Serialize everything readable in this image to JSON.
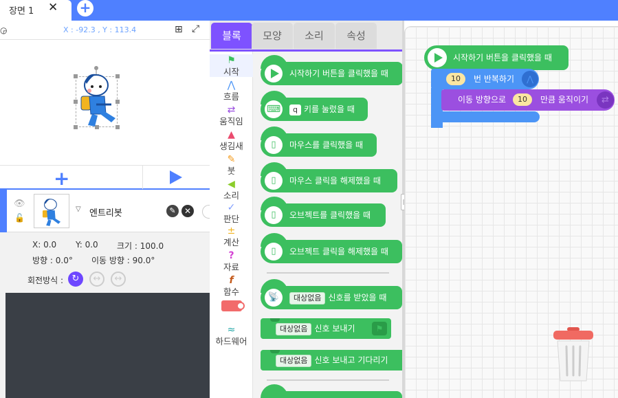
{
  "scene": {
    "tab_label": "장면 1",
    "close_glyph": "✕",
    "add_glyph": "+"
  },
  "stage": {
    "coords": "X : -92.3 ,  Y : 113.4",
    "add_object_glyph": "+"
  },
  "object": {
    "name": "엔트리봇",
    "x": "X: 0.0",
    "y": "Y: 0.0",
    "size": "크기 : 100.0",
    "direction": "방향 : 0.0°",
    "move_direction": "이동 방향 : 90.0°",
    "rotation_label": "회전방식 :"
  },
  "block_tabs": [
    "블록",
    "모양",
    "소리",
    "속성"
  ],
  "categories": [
    "시작",
    "흐름",
    "움직임",
    "생김새",
    "붓",
    "소리",
    "판단",
    "계산",
    "자료",
    "함수",
    "",
    "하드웨어"
  ],
  "palette": {
    "start_click": "시작하기 버튼을 클릭했을 때",
    "key_pressed_key": "q",
    "key_pressed": "키를 눌렀을 때",
    "mouse_click": "마우스를 클릭했을 때",
    "mouse_release": "마우스 클릭을 해제했을 때",
    "object_click": "오브젝트를 클릭했을 때",
    "object_release": "오브젝트 클릭을 해제했을 때",
    "signal_target": "대상없음",
    "signal_received": "신호를 받았을 때",
    "send_signal": "신호 보내기",
    "send_signal_wait": "신호 보내고 기다리기"
  },
  "workspace": {
    "hat": "시작하기 버튼을 클릭했을 때",
    "repeat_count": "10",
    "repeat": "번 반복하기",
    "move_prefix": "이동 방향으로",
    "move_amount": "10",
    "move_suffix": "만큼 움직이기"
  },
  "colors": {
    "accent": "#4f80ff",
    "block_tab": "#7e52ff",
    "start_block": "#3cbf5f",
    "flow_block": "#4c95f6",
    "move_block": "#9b4fe0",
    "trash_lid": "#f06a62"
  },
  "icons": [
    "close-icon",
    "add-scene-icon",
    "speed-icon",
    "grid-icon",
    "fullscreen-icon",
    "plus-icon",
    "play-icon",
    "eye-icon",
    "lock-icon",
    "edit-icon",
    "delete-icon",
    "rotate-icon",
    "flag-icon",
    "trash-icon"
  ]
}
